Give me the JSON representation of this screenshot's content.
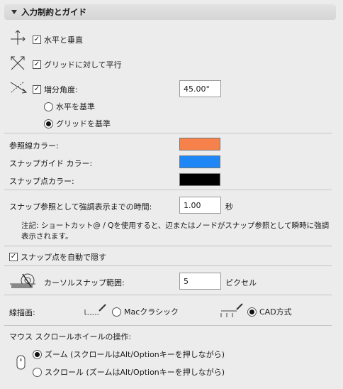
{
  "header": {
    "title": "入力制約とガイド"
  },
  "constraints": {
    "horizontal_vertical": {
      "label": "水平と垂直",
      "checked": true
    },
    "parallel_grid": {
      "label": "グリッドに対して平行",
      "checked": true
    },
    "angle_increment": {
      "label": "増分角度:",
      "checked": true,
      "value": "45.00°"
    },
    "base_horizontal": {
      "label": "水平を基準",
      "selected": false
    },
    "base_grid": {
      "label": "グリッドを基準",
      "selected": true
    }
  },
  "colors": {
    "reference_line": {
      "label": "参照線カラー:",
      "color": "#f7814a"
    },
    "snap_guide": {
      "label": "スナップガイド カラー:",
      "color": "#1e86f5"
    },
    "snap_point": {
      "label": "スナップ点カラー:",
      "color": "#000000"
    }
  },
  "highlight": {
    "label": "スナップ参照として強調表示までの時間:",
    "value": "1.00",
    "unit": "秒",
    "note": "注記: ショートカット@ / Qを使用すると、辺またはノードがスナップ参照として瞬時に強調表示されます。"
  },
  "auto_hide": {
    "label": "スナップ点を自動で隠す",
    "checked": true
  },
  "cursor_snap": {
    "label": "カーソルスナップ範囲:",
    "value": "5",
    "unit": "ピクセル"
  },
  "line_drawing": {
    "label": "線描画:",
    "mac_classic": {
      "label": "Macクラシック",
      "selected": false
    },
    "cad_style": {
      "label": "CAD方式",
      "selected": true
    }
  },
  "mouse_wheel": {
    "label": "マウス スクロールホイールの操作:",
    "zoom": {
      "label": "ズーム (スクロールはAlt/Optionキーを押しながら)",
      "selected": true
    },
    "scroll": {
      "label": "スクロール (ズームはAlt/Optionキーを押しながら)",
      "selected": false
    }
  }
}
